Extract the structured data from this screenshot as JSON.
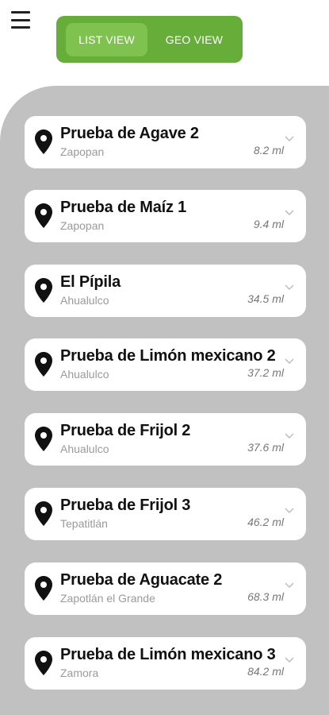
{
  "header": {
    "menu_icon": "hamburger-menu-icon",
    "toggle": {
      "list_label": "LIST VIEW",
      "geo_label": "GEO VIEW",
      "active": "list"
    }
  },
  "colors": {
    "toggle_bg": "#67ad3a",
    "toggle_active": "#7fc24f",
    "panel_bg": "#c1c1c1",
    "card_bg": "#ffffff"
  },
  "list": {
    "items": [
      {
        "title": "Prueba de Agave 2",
        "location": "Zapopan",
        "distance": "8.2 ml",
        "icon": "location-pin-icon"
      },
      {
        "title": "Prueba de Maíz 1",
        "location": "Zapopan",
        "distance": "9.4 ml",
        "icon": "location-pin-icon"
      },
      {
        "title": "El Pípila",
        "location": "Ahualulco",
        "distance": "34.5 ml",
        "icon": "location-pin-icon"
      },
      {
        "title": "Prueba de Limón mexicano 2",
        "location": "Ahualulco",
        "distance": "37.2 ml",
        "icon": "location-pin-icon"
      },
      {
        "title": "Prueba de Frijol 2",
        "location": "Ahualulco",
        "distance": "37.6 ml",
        "icon": "location-pin-icon"
      },
      {
        "title": "Prueba de Frijol 3",
        "location": "Tepatitlán",
        "distance": "46.2 ml",
        "icon": "location-pin-icon"
      },
      {
        "title": "Prueba de Aguacate 2",
        "location": "Zapotlán el Grande",
        "distance": "68.3 ml",
        "icon": "location-pin-icon"
      },
      {
        "title": "Prueba de Limón mexicano 3",
        "location": "Zamora",
        "distance": "84.2 ml",
        "icon": "location-pin-icon"
      }
    ]
  }
}
